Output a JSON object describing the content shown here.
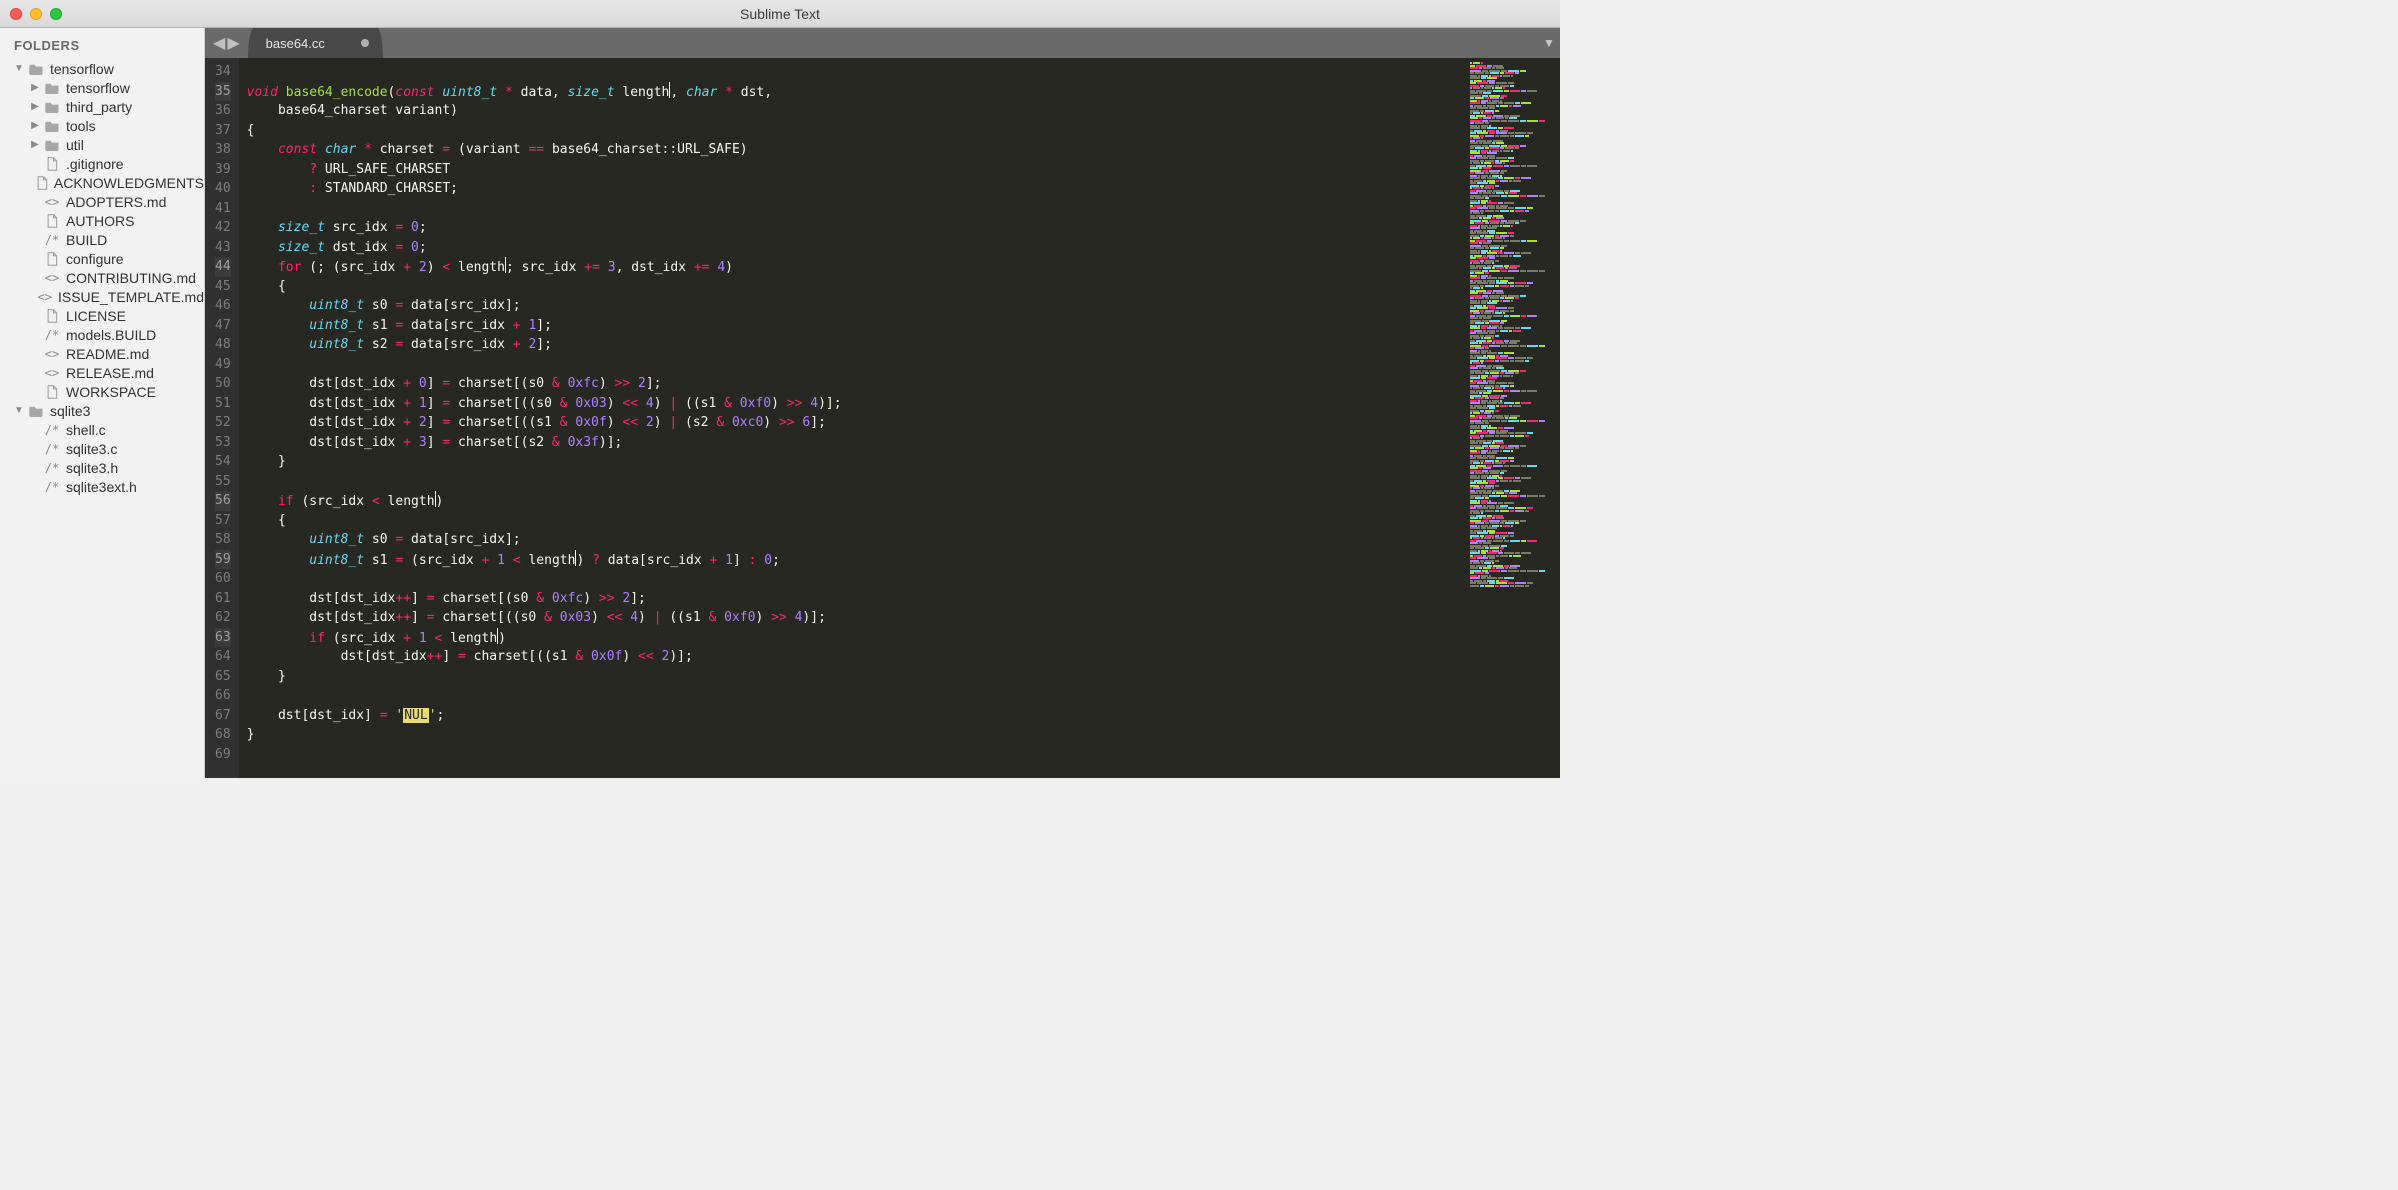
{
  "window": {
    "title": "Sublime Text"
  },
  "sidebar": {
    "heading": "FOLDERS",
    "roots": [
      {
        "name": "tensorflow",
        "expanded": true,
        "folders": [
          {
            "name": "tensorflow"
          },
          {
            "name": "third_party"
          },
          {
            "name": "tools"
          },
          {
            "name": "util"
          }
        ],
        "files": [
          {
            "name": ".gitignore",
            "glyph": "doc"
          },
          {
            "name": "ACKNOWLEDGMENTS",
            "glyph": "doc"
          },
          {
            "name": "ADOPTERS.md",
            "glyph": "angle"
          },
          {
            "name": "AUTHORS",
            "glyph": "doc"
          },
          {
            "name": "BUILD",
            "glyph": "slash"
          },
          {
            "name": "configure",
            "glyph": "doc"
          },
          {
            "name": "CONTRIBUTING.md",
            "glyph": "angle"
          },
          {
            "name": "ISSUE_TEMPLATE.md",
            "glyph": "angle"
          },
          {
            "name": "LICENSE",
            "glyph": "doc"
          },
          {
            "name": "models.BUILD",
            "glyph": "slash"
          },
          {
            "name": "README.md",
            "glyph": "angle"
          },
          {
            "name": "RELEASE.md",
            "glyph": "angle"
          },
          {
            "name": "WORKSPACE",
            "glyph": "doc"
          }
        ]
      },
      {
        "name": "sqlite3",
        "expanded": true,
        "folders": [],
        "files": [
          {
            "name": "shell.c",
            "glyph": "slash"
          },
          {
            "name": "sqlite3.c",
            "glyph": "slash"
          },
          {
            "name": "sqlite3.h",
            "glyph": "slash"
          },
          {
            "name": "sqlite3ext.h",
            "glyph": "slash"
          }
        ]
      }
    ]
  },
  "tabs": {
    "active": {
      "label": "base64.cc",
      "dirty": true
    }
  },
  "editor": {
    "first_line_number": 34,
    "highlighted_lines": [
      35,
      44,
      56,
      59,
      63
    ],
    "lines": [
      [],
      [
        [
          "kw",
          "void"
        ],
        [
          "pn",
          " "
        ],
        [
          "fn",
          "base64_encode"
        ],
        [
          "pn",
          "("
        ],
        [
          "kw",
          "const"
        ],
        [
          "pn",
          " "
        ],
        [
          "type",
          "uint8_t"
        ],
        [
          "pn",
          " "
        ],
        [
          "op",
          "*"
        ],
        [
          "pn",
          " data, "
        ],
        [
          "type",
          "size_t"
        ],
        [
          "pn",
          " length"
        ],
        [
          "cursor",
          ""
        ],
        [
          "pn",
          ", "
        ],
        [
          "type",
          "char"
        ],
        [
          "pn",
          " "
        ],
        [
          "op",
          "*"
        ],
        [
          "pn",
          " dst,"
        ]
      ],
      [
        [
          "pn",
          "    base64_charset variant)"
        ]
      ],
      [
        [
          "pn",
          "{"
        ]
      ],
      [
        [
          "pn",
          "    "
        ],
        [
          "kw",
          "const"
        ],
        [
          "pn",
          " "
        ],
        [
          "type",
          "char"
        ],
        [
          "pn",
          " "
        ],
        [
          "op",
          "*"
        ],
        [
          "pn",
          " charset "
        ],
        [
          "op",
          "="
        ],
        [
          "pn",
          " (variant "
        ],
        [
          "op",
          "=="
        ],
        [
          "pn",
          " base64_charset::URL_SAFE)"
        ]
      ],
      [
        [
          "pn",
          "        "
        ],
        [
          "op",
          "?"
        ],
        [
          "pn",
          " URL_SAFE_CHARSET"
        ]
      ],
      [
        [
          "pn",
          "        "
        ],
        [
          "op",
          ":"
        ],
        [
          "pn",
          " STANDARD_CHARSET;"
        ]
      ],
      [],
      [
        [
          "pn",
          "    "
        ],
        [
          "type",
          "size_t"
        ],
        [
          "pn",
          " src_idx "
        ],
        [
          "op",
          "="
        ],
        [
          "pn",
          " "
        ],
        [
          "num",
          "0"
        ],
        [
          "pn",
          ";"
        ]
      ],
      [
        [
          "pn",
          "    "
        ],
        [
          "type",
          "size_t"
        ],
        [
          "pn",
          " dst_idx "
        ],
        [
          "op",
          "="
        ],
        [
          "pn",
          " "
        ],
        [
          "num",
          "0"
        ],
        [
          "pn",
          ";"
        ]
      ],
      [
        [
          "pn",
          "    "
        ],
        [
          "kw2",
          "for"
        ],
        [
          "pn",
          " (; (src_idx "
        ],
        [
          "op",
          "+"
        ],
        [
          "pn",
          " "
        ],
        [
          "num",
          "2"
        ],
        [
          "pn",
          ") "
        ],
        [
          "op",
          "<"
        ],
        [
          "pn",
          " length"
        ],
        [
          "cursor",
          ""
        ],
        [
          "pn",
          "; src_idx "
        ],
        [
          "op",
          "+="
        ],
        [
          "pn",
          " "
        ],
        [
          "num",
          "3"
        ],
        [
          "pn",
          ", dst_idx "
        ],
        [
          "op",
          "+="
        ],
        [
          "pn",
          " "
        ],
        [
          "num",
          "4"
        ],
        [
          "pn",
          ")"
        ]
      ],
      [
        [
          "pn",
          "    {"
        ]
      ],
      [
        [
          "pn",
          "        "
        ],
        [
          "type",
          "uint8_t"
        ],
        [
          "pn",
          " s0 "
        ],
        [
          "op",
          "="
        ],
        [
          "pn",
          " data[src_idx];"
        ]
      ],
      [
        [
          "pn",
          "        "
        ],
        [
          "type",
          "uint8_t"
        ],
        [
          "pn",
          " s1 "
        ],
        [
          "op",
          "="
        ],
        [
          "pn",
          " data[src_idx "
        ],
        [
          "op",
          "+"
        ],
        [
          "pn",
          " "
        ],
        [
          "num",
          "1"
        ],
        [
          "pn",
          "];"
        ]
      ],
      [
        [
          "pn",
          "        "
        ],
        [
          "type",
          "uint8_t"
        ],
        [
          "pn",
          " s2 "
        ],
        [
          "op",
          "="
        ],
        [
          "pn",
          " data[src_idx "
        ],
        [
          "op",
          "+"
        ],
        [
          "pn",
          " "
        ],
        [
          "num",
          "2"
        ],
        [
          "pn",
          "];"
        ]
      ],
      [],
      [
        [
          "pn",
          "        dst[dst_idx "
        ],
        [
          "op",
          "+"
        ],
        [
          "pn",
          " "
        ],
        [
          "num",
          "0"
        ],
        [
          "pn",
          "] "
        ],
        [
          "op",
          "="
        ],
        [
          "pn",
          " charset[(s0 "
        ],
        [
          "op",
          "&"
        ],
        [
          "pn",
          " "
        ],
        [
          "num",
          "0xfc"
        ],
        [
          "pn",
          ") "
        ],
        [
          "op",
          ">>"
        ],
        [
          "pn",
          " "
        ],
        [
          "num",
          "2"
        ],
        [
          "pn",
          "];"
        ]
      ],
      [
        [
          "pn",
          "        dst[dst_idx "
        ],
        [
          "op",
          "+"
        ],
        [
          "pn",
          " "
        ],
        [
          "num",
          "1"
        ],
        [
          "pn",
          "] "
        ],
        [
          "op",
          "="
        ],
        [
          "pn",
          " charset[((s0 "
        ],
        [
          "op",
          "&"
        ],
        [
          "pn",
          " "
        ],
        [
          "num",
          "0x03"
        ],
        [
          "pn",
          ") "
        ],
        [
          "op",
          "<<"
        ],
        [
          "pn",
          " "
        ],
        [
          "num",
          "4"
        ],
        [
          "pn",
          ") "
        ],
        [
          "op",
          "|"
        ],
        [
          "pn",
          " ((s1 "
        ],
        [
          "op",
          "&"
        ],
        [
          "pn",
          " "
        ],
        [
          "num",
          "0xf0"
        ],
        [
          "pn",
          ") "
        ],
        [
          "op",
          ">>"
        ],
        [
          "pn",
          " "
        ],
        [
          "num",
          "4"
        ],
        [
          "pn",
          ")];"
        ]
      ],
      [
        [
          "pn",
          "        dst[dst_idx "
        ],
        [
          "op",
          "+"
        ],
        [
          "pn",
          " "
        ],
        [
          "num",
          "2"
        ],
        [
          "pn",
          "] "
        ],
        [
          "op",
          "="
        ],
        [
          "pn",
          " charset[((s1 "
        ],
        [
          "op",
          "&"
        ],
        [
          "pn",
          " "
        ],
        [
          "num",
          "0x0f"
        ],
        [
          "pn",
          ") "
        ],
        [
          "op",
          "<<"
        ],
        [
          "pn",
          " "
        ],
        [
          "num",
          "2"
        ],
        [
          "pn",
          ") "
        ],
        [
          "op",
          "|"
        ],
        [
          "pn",
          " (s2 "
        ],
        [
          "op",
          "&"
        ],
        [
          "pn",
          " "
        ],
        [
          "num",
          "0xc0"
        ],
        [
          "pn",
          ") "
        ],
        [
          "op",
          ">>"
        ],
        [
          "pn",
          " "
        ],
        [
          "num",
          "6"
        ],
        [
          "pn",
          "];"
        ]
      ],
      [
        [
          "pn",
          "        dst[dst_idx "
        ],
        [
          "op",
          "+"
        ],
        [
          "pn",
          " "
        ],
        [
          "num",
          "3"
        ],
        [
          "pn",
          "] "
        ],
        [
          "op",
          "="
        ],
        [
          "pn",
          " charset[(s2 "
        ],
        [
          "op",
          "&"
        ],
        [
          "pn",
          " "
        ],
        [
          "num",
          "0x3f"
        ],
        [
          "pn",
          ")];"
        ]
      ],
      [
        [
          "pn",
          "    }"
        ]
      ],
      [],
      [
        [
          "pn",
          "    "
        ],
        [
          "kw2",
          "if"
        ],
        [
          "pn",
          " (src_idx "
        ],
        [
          "op",
          "<"
        ],
        [
          "pn",
          " length"
        ],
        [
          "cursor",
          ""
        ],
        [
          "pn",
          ")"
        ]
      ],
      [
        [
          "pn",
          "    {"
        ]
      ],
      [
        [
          "pn",
          "        "
        ],
        [
          "type",
          "uint8_t"
        ],
        [
          "pn",
          " s0 "
        ],
        [
          "op",
          "="
        ],
        [
          "pn",
          " data[src_idx];"
        ]
      ],
      [
        [
          "pn",
          "        "
        ],
        [
          "type",
          "uint8_t"
        ],
        [
          "pn",
          " s1 "
        ],
        [
          "op",
          "="
        ],
        [
          "pn",
          " (src_idx "
        ],
        [
          "op",
          "+"
        ],
        [
          "pn",
          " "
        ],
        [
          "num",
          "1"
        ],
        [
          "pn",
          " "
        ],
        [
          "op",
          "<"
        ],
        [
          "pn",
          " length"
        ],
        [
          "cursor",
          ""
        ],
        [
          "pn",
          ") "
        ],
        [
          "op",
          "?"
        ],
        [
          "pn",
          " data[src_idx "
        ],
        [
          "op",
          "+"
        ],
        [
          "pn",
          " "
        ],
        [
          "num",
          "1"
        ],
        [
          "pn",
          "] "
        ],
        [
          "op",
          ":"
        ],
        [
          "pn",
          " "
        ],
        [
          "num",
          "0"
        ],
        [
          "pn",
          ";"
        ]
      ],
      [],
      [
        [
          "pn",
          "        dst[dst_idx"
        ],
        [
          "op",
          "++"
        ],
        [
          "pn",
          "] "
        ],
        [
          "op",
          "="
        ],
        [
          "pn",
          " charset[(s0 "
        ],
        [
          "op",
          "&"
        ],
        [
          "pn",
          " "
        ],
        [
          "num",
          "0xfc"
        ],
        [
          "pn",
          ") "
        ],
        [
          "op",
          ">>"
        ],
        [
          "pn",
          " "
        ],
        [
          "num",
          "2"
        ],
        [
          "pn",
          "];"
        ]
      ],
      [
        [
          "pn",
          "        dst[dst_idx"
        ],
        [
          "op",
          "++"
        ],
        [
          "pn",
          "] "
        ],
        [
          "op",
          "="
        ],
        [
          "pn",
          " charset[((s0 "
        ],
        [
          "op",
          "&"
        ],
        [
          "pn",
          " "
        ],
        [
          "num",
          "0x03"
        ],
        [
          "pn",
          ") "
        ],
        [
          "op",
          "<<"
        ],
        [
          "pn",
          " "
        ],
        [
          "num",
          "4"
        ],
        [
          "pn",
          ") "
        ],
        [
          "op",
          "|"
        ],
        [
          "pn",
          " ((s1 "
        ],
        [
          "op",
          "&"
        ],
        [
          "pn",
          " "
        ],
        [
          "num",
          "0xf0"
        ],
        [
          "pn",
          ") "
        ],
        [
          "op",
          ">>"
        ],
        [
          "pn",
          " "
        ],
        [
          "num",
          "4"
        ],
        [
          "pn",
          ")];"
        ]
      ],
      [
        [
          "pn",
          "        "
        ],
        [
          "kw2",
          "if"
        ],
        [
          "pn",
          " (src_idx "
        ],
        [
          "op",
          "+"
        ],
        [
          "pn",
          " "
        ],
        [
          "num",
          "1"
        ],
        [
          "pn",
          " "
        ],
        [
          "op",
          "<"
        ],
        [
          "pn",
          " length"
        ],
        [
          "cursor",
          ""
        ],
        [
          "pn",
          ")"
        ]
      ],
      [
        [
          "pn",
          "            dst[dst_idx"
        ],
        [
          "op",
          "++"
        ],
        [
          "pn",
          "] "
        ],
        [
          "op",
          "="
        ],
        [
          "pn",
          " charset[((s1 "
        ],
        [
          "op",
          "&"
        ],
        [
          "pn",
          " "
        ],
        [
          "num",
          "0x0f"
        ],
        [
          "pn",
          ") "
        ],
        [
          "op",
          "<<"
        ],
        [
          "pn",
          " "
        ],
        [
          "num",
          "2"
        ],
        [
          "pn",
          ")];"
        ]
      ],
      [
        [
          "pn",
          "    }"
        ]
      ],
      [],
      [
        [
          "pn",
          "    dst[dst_idx] "
        ],
        [
          "op",
          "="
        ],
        [
          "pn",
          " "
        ],
        [
          "str",
          "'"
        ],
        [
          "strnul",
          "NUL"
        ],
        [
          "str",
          "'"
        ],
        [
          "pn",
          ";"
        ]
      ],
      [
        [
          "pn",
          "}"
        ]
      ],
      []
    ]
  }
}
